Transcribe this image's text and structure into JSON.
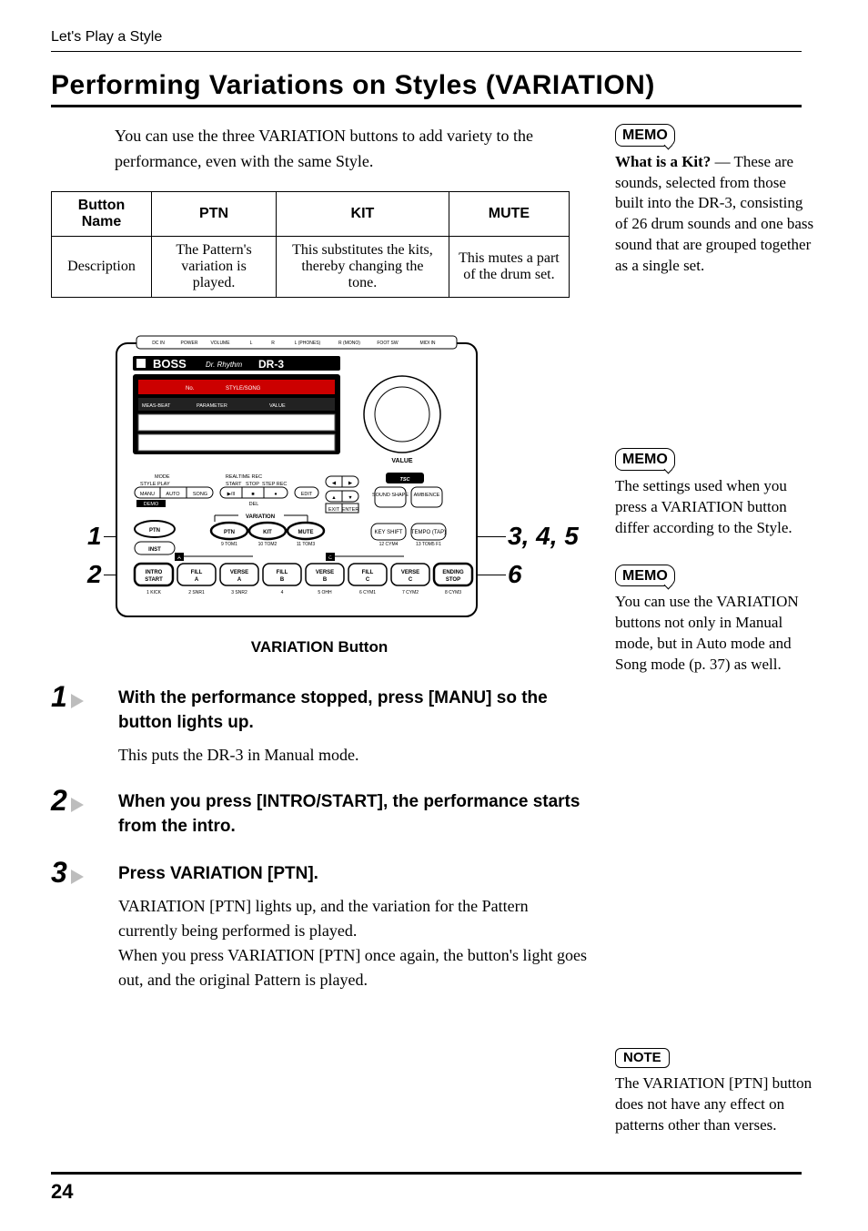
{
  "running_head": "Let's Play a Style",
  "title": "Performing Variations on Styles (VARIATION)",
  "intro": "You can use the three VARIATION buttons to add variety to the performance, even with the same Style.",
  "table": {
    "headers": [
      "Button Name",
      "PTN",
      "KIT",
      "MUTE"
    ],
    "row_label": "Description",
    "cells": [
      "The Pattern's variation is played.",
      "This substitutes the kits, thereby changing the tone.",
      "This mutes a part of the drum set."
    ]
  },
  "figure": {
    "caption": "VARIATION Button",
    "callouts": {
      "one": "1",
      "two": "2",
      "three_four_five": "3, 4, 5",
      "six": "6"
    },
    "device": {
      "brand": "BOSS",
      "sub": "Dr. Rhythm",
      "model": "DR-3",
      "top_jacks": [
        "DC IN",
        "POWER",
        "VOLUME",
        "L",
        "R",
        "L (PHONES)",
        "R (MONO)",
        "FOOT SW",
        "MIDI IN"
      ],
      "lcd_upper": [
        "No.",
        "STYLE/SONG"
      ],
      "lcd_lower": [
        "MEAS-BEAT",
        "PARAMETER",
        "VALUE"
      ],
      "value_label": "VALUE",
      "tsc": "TSC",
      "mode_label": "MODE",
      "style_play": "STYLE PLAY",
      "mode_btns": [
        "MANU",
        "AUTO",
        "SONG"
      ],
      "demo": "DEMO",
      "realtime": "REALTIME REC",
      "rt_btns": [
        "START",
        "STOP",
        "STEP REC"
      ],
      "transport": [
        "▶/II",
        "■",
        "●"
      ],
      "del": "DEL",
      "edit": "EDIT",
      "arrows_lr": [
        "◀",
        "▶"
      ],
      "arrows_ud": [
        "▲",
        "▼"
      ],
      "exit_enter": [
        "EXIT",
        "ENTER"
      ],
      "sound_shape": "SOUND SHAPE",
      "ambience": "AMBIENCE",
      "variation_label": "VARIATION",
      "left_btns": [
        "PTN",
        "INST"
      ],
      "var_btns": [
        "PTN",
        "KIT",
        "MUTE"
      ],
      "key_shift": "KEY SHIFT",
      "tempo": "TEMPO (TAP)",
      "sub_labels": [
        "9 TOM1",
        "10 TOM2",
        "11 TOM3",
        "12 CYM4",
        "13 TOM5 F1"
      ],
      "section_a": "A",
      "section_c": "C",
      "pads": [
        "INTRO START",
        "FILL A",
        "VERSE A",
        "FILL B",
        "VERSE B",
        "FILL C",
        "VERSE C",
        "ENDING STOP"
      ],
      "pad_subs": [
        "1 KICK",
        "2 SNR1",
        "3 SNR2",
        "4",
        "5 OHH",
        "6 CYM1",
        "7 CYM2",
        "8 CYM3"
      ]
    }
  },
  "steps": [
    {
      "num": "1",
      "head": "With the performance stopped, press [MANU] so the button lights up.",
      "body": "This puts the DR-3 in Manual mode."
    },
    {
      "num": "2",
      "head": "When you press [INTRO/START], the performance starts from the intro.",
      "body": ""
    },
    {
      "num": "3",
      "head": "Press VARIATION [PTN].",
      "body": "VARIATION [PTN] lights up, and the variation for the Pattern currently being performed is played.\nWhen you press VARIATION [PTN] once again, the button's light goes out, and the original Pattern is played."
    }
  ],
  "memos": [
    {
      "label": "MEMO",
      "html": "<b>What is a Kit?</b> — These are sounds, selected from those built into the DR-3, consisting of 26 drum sounds and one bass sound that are grouped together as a single set."
    },
    {
      "label": "MEMO",
      "html": "The settings used when you press a VARIATION button differ according to the Style."
    },
    {
      "label": "MEMO",
      "html": "You can use the VARIATION buttons not only in Manual mode, but in Auto mode and Song mode (p. 37) as well."
    }
  ],
  "note": {
    "label": "NOTE",
    "text": "The VARIATION [PTN] button does not have any effect on patterns other than verses."
  },
  "page_number": "24"
}
